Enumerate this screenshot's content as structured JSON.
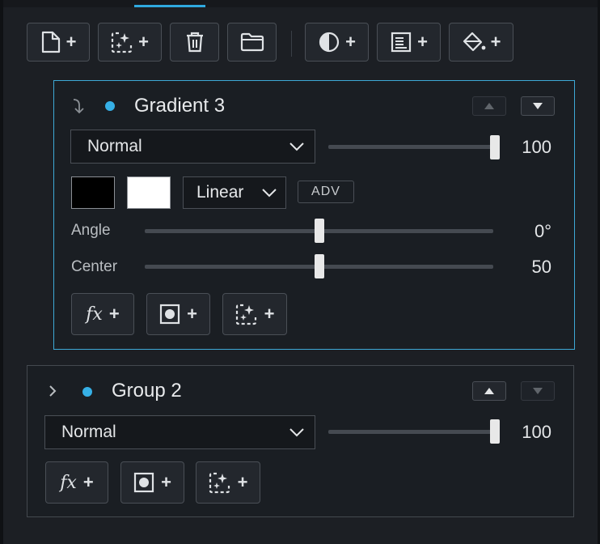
{
  "toolbar": {
    "buttons": [
      {
        "name": "new-layer",
        "icon": "new-file-icon"
      },
      {
        "name": "new-effect",
        "icon": "sparkle-frame-icon"
      },
      {
        "name": "delete",
        "icon": "trash-icon"
      },
      {
        "name": "group-folder",
        "icon": "folder-icon"
      },
      {
        "name": "adjustment",
        "icon": "contrast-icon"
      },
      {
        "name": "text-layer",
        "icon": "text-frame-icon"
      },
      {
        "name": "fill-layer",
        "icon": "paint-bucket-icon"
      }
    ],
    "plus": "+"
  },
  "layers": {
    "gradient": {
      "title": "Gradient 3",
      "blend_mode": "Normal",
      "opacity": 100,
      "opacity_label": "100",
      "color_start": "#000000",
      "color_end": "#ffffff",
      "gradient_type": "Linear",
      "adv_label": "ADV",
      "angle_label": "Angle",
      "angle_value": "0°",
      "angle_fraction": 0.5,
      "center_label": "Center",
      "center_value": "50",
      "center_fraction": 0.5,
      "fx_label": "fx",
      "plus": "+"
    },
    "group": {
      "title": "Group 2",
      "blend_mode": "Normal",
      "opacity": 100,
      "opacity_label": "100",
      "fx_label": "fx",
      "plus": "+"
    }
  },
  "colors": {
    "accent": "#2fa9e0",
    "selected_border": "#3ea9d6",
    "background": "#1c1f24"
  }
}
